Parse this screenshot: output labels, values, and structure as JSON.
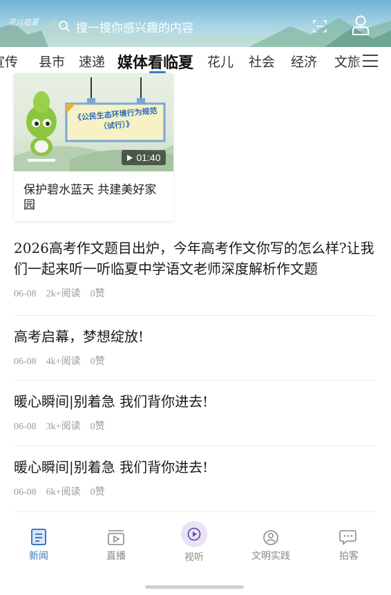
{
  "header": {
    "logo_text": "花儿临夏",
    "search_placeholder": "搜一搜你感兴趣的内容"
  },
  "tabs": [
    {
      "label": "宣传"
    },
    {
      "label": "县市"
    },
    {
      "label": "速递"
    },
    {
      "label": "媒体看临夏",
      "active": true
    },
    {
      "label": "花儿"
    },
    {
      "label": "社会"
    },
    {
      "label": "经济"
    },
    {
      "label": "文旅"
    }
  ],
  "video_card": {
    "banner_text": "《公民生态环境行为规范（试行）》",
    "duration": "01:40",
    "title": "保护碧水蓝天 共建美好家园"
  },
  "news": [
    {
      "title": "2026高考作文题目出炉，今年高考作文你写的怎么样?让我们一起来听一听临夏中学语文老师深度解析作文题",
      "date": "06-08",
      "reads": "2k+阅读",
      "likes": "0赞"
    },
    {
      "title": "高考启幕，梦想绽放!",
      "date": "06-08",
      "reads": "4k+阅读",
      "likes": "0赞"
    },
    {
      "title": "暖心瞬间|别着急 我们背你进去!",
      "date": "06-08",
      "reads": "3k+阅读",
      "likes": "0赞"
    },
    {
      "title": "暖心瞬间|别着急 我们背你进去!",
      "date": "06-08",
      "reads": "6k+阅读",
      "likes": "0赞"
    }
  ],
  "bottom_nav": [
    {
      "label": "新闻",
      "icon": "news-icon",
      "active": true
    },
    {
      "label": "直播",
      "icon": "live-icon"
    },
    {
      "label": "视听",
      "icon": "play-icon"
    },
    {
      "label": "文明实践",
      "icon": "civilization-icon"
    },
    {
      "label": "拍客",
      "icon": "chat-icon"
    }
  ],
  "colors": {
    "accent": "#3a78c2",
    "header_sky": "#6fb3d3",
    "meta_text": "#9a9a9a"
  }
}
